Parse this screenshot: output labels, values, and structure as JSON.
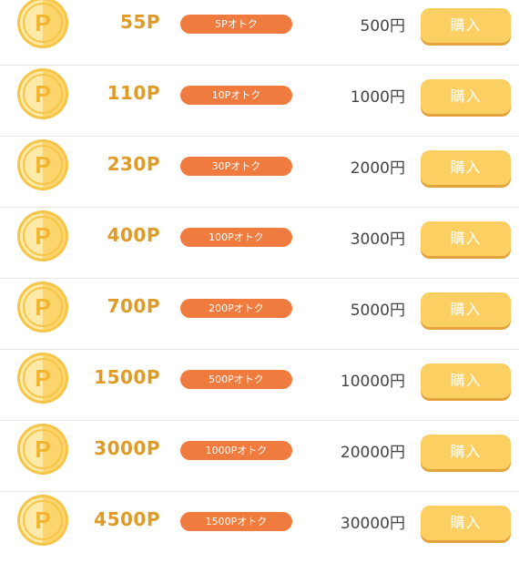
{
  "colors": {
    "points_text": "#e09a26",
    "badge_bg": "#ef7b3e",
    "button_bg": "#fbcf62",
    "button_shadow": "#e4a23a",
    "coin_light": "#fde9a8",
    "coin_dark": "#fbd46c",
    "coin_rim": "#f6c548"
  },
  "coin_icon": "p-coin-icon",
  "products": [
    {
      "points": "55P",
      "bonus": "5Pオトク",
      "price": "500円",
      "button": "購入"
    },
    {
      "points": "110P",
      "bonus": "10Pオトク",
      "price": "1000円",
      "button": "購入"
    },
    {
      "points": "230P",
      "bonus": "30Pオトク",
      "price": "2000円",
      "button": "購入"
    },
    {
      "points": "400P",
      "bonus": "100Pオトク",
      "price": "3000円",
      "button": "購入"
    },
    {
      "points": "700P",
      "bonus": "200Pオトク",
      "price": "5000円",
      "button": "購入"
    },
    {
      "points": "1500P",
      "bonus": "500Pオトク",
      "price": "10000円",
      "button": "購入"
    },
    {
      "points": "3000P",
      "bonus": "1000Pオトク",
      "price": "20000円",
      "button": "購入"
    },
    {
      "points": "4500P",
      "bonus": "1500Pオトク",
      "price": "30000円",
      "button": "購入"
    }
  ]
}
